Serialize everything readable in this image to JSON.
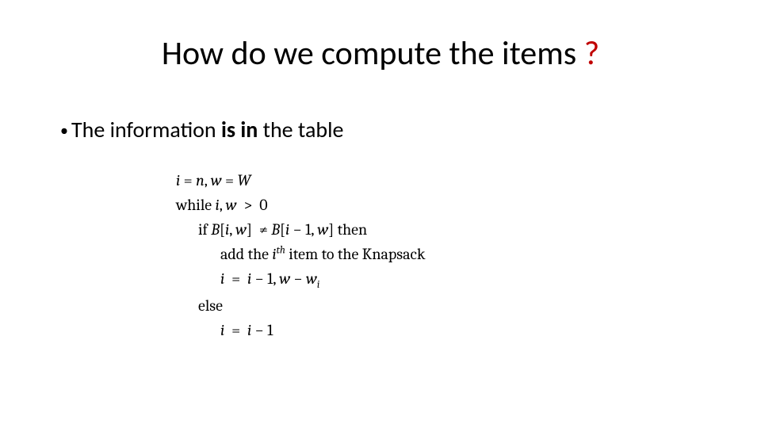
{
  "title": {
    "main": "How do we compute the items ",
    "punct": "?"
  },
  "bullet": {
    "pre": "The information ",
    "bold": "is in",
    "post": " the table"
  },
  "code": {
    "l1_a": "i",
    "l1_b": " = ",
    "l1_c": "n",
    "l1_d": ", ",
    "l1_e": "w",
    "l1_f": " = ",
    "l1_g": "W",
    "l2_a": "while ",
    "l2_b": "i",
    "l2_c": ", ",
    "l2_d": "w",
    "l2_e": "  >  0",
    "l3_a": "if ",
    "l3_b": "B",
    "l3_c": "[",
    "l3_d": "i",
    "l3_e": ", ",
    "l3_f": "w",
    "l3_g": "]  ≠ ",
    "l3_h": "B",
    "l3_i": "[",
    "l3_j": "i",
    "l3_k": " − 1, ",
    "l3_l": "w",
    "l3_m": "] then",
    "l4_a": "add the ",
    "l4_b": "i",
    "l4_c": "th",
    "l4_d": " item to the Knapsack",
    "l5_a": "i",
    "l5_b": "  =  ",
    "l5_c": "i",
    "l5_d": " − 1, ",
    "l5_e": "w",
    "l5_f": " − ",
    "l5_g": "w",
    "l5_h": "i",
    "l6": "else",
    "l7_a": "i",
    "l7_b": "  =  ",
    "l7_c": "i",
    "l7_d": " − 1"
  }
}
